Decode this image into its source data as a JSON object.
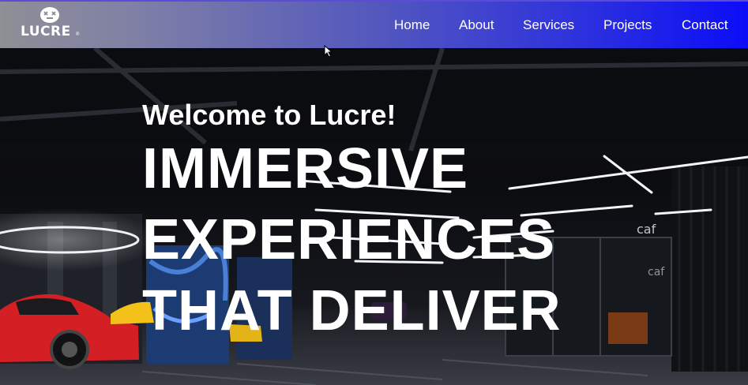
{
  "brand": {
    "name": "LUCRE",
    "registered": "®",
    "logo_icon": "dizzy-face-icon"
  },
  "nav": {
    "items": [
      {
        "label": "Home"
      },
      {
        "label": "About"
      },
      {
        "label": "Services"
      },
      {
        "label": "Projects"
      },
      {
        "label": "Contact"
      }
    ]
  },
  "hero": {
    "welcome": "Welcome to Lucre!",
    "headline_lines": [
      "IMMERSIVE",
      "EXPERIENCES",
      "THAT DELIVER"
    ],
    "background_signs": [
      "caf",
      "caf"
    ]
  },
  "colors": {
    "nav_gradient_start": "#8f8f95",
    "nav_gradient_end": "#0c0cf8",
    "text": "#ffffff"
  }
}
